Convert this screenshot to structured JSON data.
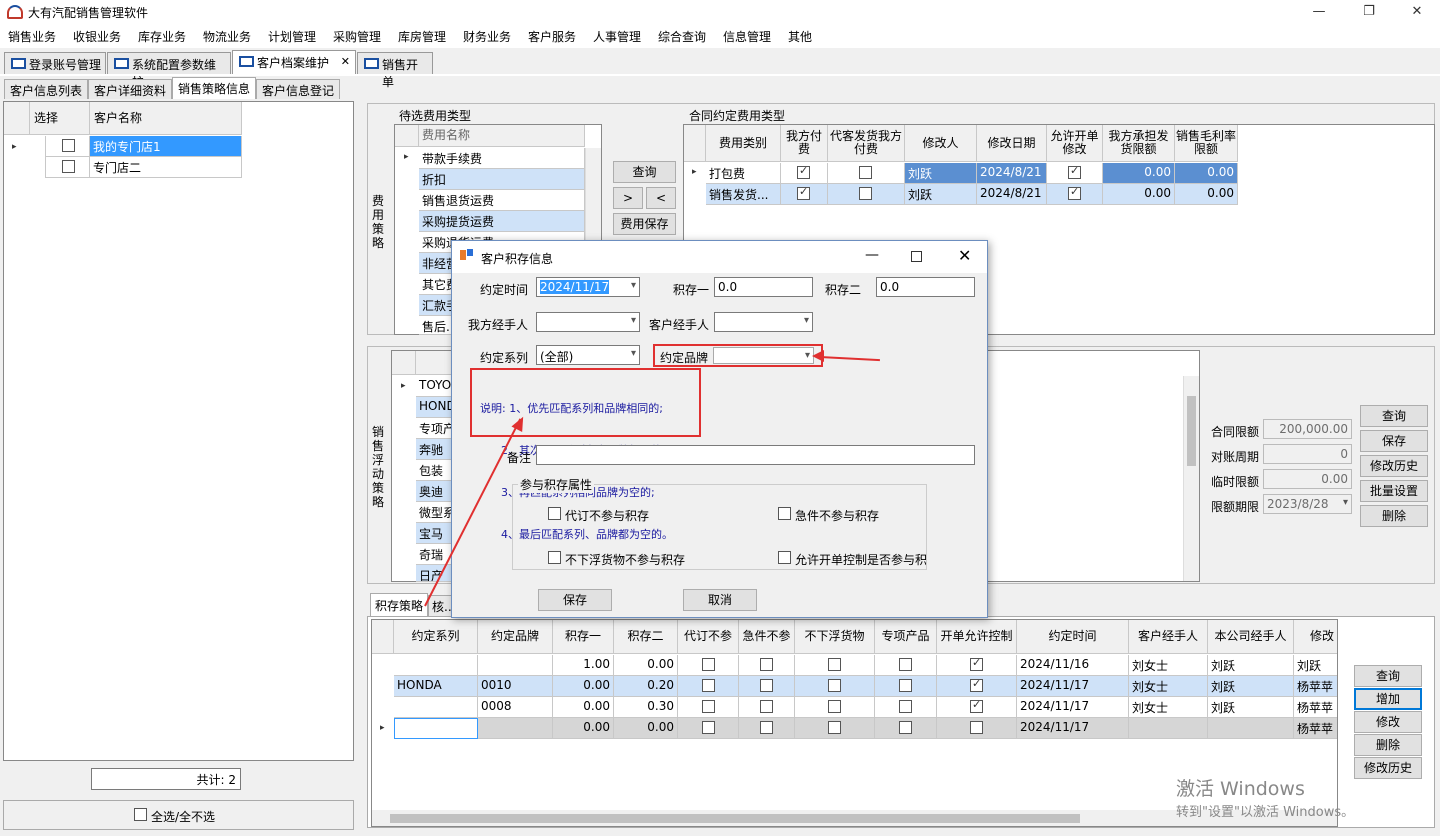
{
  "app": {
    "title": "大有汽配销售管理软件"
  },
  "window": {
    "min": "—",
    "restore": "❐",
    "close": "✕"
  },
  "menu": [
    "销售业务",
    "收银业务",
    "库存业务",
    "物流业务",
    "计划管理",
    "采购管理",
    "库房管理",
    "财务业务",
    "客户服务",
    "人事管理",
    "综合查询",
    "信息管理",
    "其他"
  ],
  "main_tabs": [
    {
      "label": "登录账号管理"
    },
    {
      "label": "系统配置参数维护"
    },
    {
      "label": "客户档案维护",
      "close": "✕"
    },
    {
      "label": "销售开单"
    }
  ],
  "sub_tabs": [
    "客户信息列表",
    "客户详细资料",
    "销售策略信息",
    "客户信息登记"
  ],
  "customer_list": {
    "headers": [
      "选择",
      "客户名称"
    ],
    "rows": [
      {
        "name": "我的专门店1",
        "checked": false
      },
      {
        "name": "专门店二",
        "checked": false
      }
    ],
    "total": "共计: 2",
    "select_all": "全选/全不选"
  },
  "fee_strategy": {
    "label": "费用策略",
    "pending_title": "待选费用类型",
    "pending_header": "费用名称",
    "pending_items": [
      "带款手续费",
      "折扣",
      "销售退货运费",
      "采购提货运费",
      "采购退货运费",
      "非经营...",
      "其它费...",
      "汇款手...",
      "售后..."
    ],
    "buttons": {
      "query": "查询",
      "add": ">",
      "remove": "<",
      "save": "费用保存"
    },
    "contract_title": "合同约定费用类型",
    "contract_headers": [
      "费用类别",
      "我方付费",
      "代客发货我方付费",
      "修改人",
      "修改日期",
      "允许开单修改",
      "我方承担发货限额",
      "销售毛利率限额"
    ],
    "contract_rows": [
      {
        "type": "打包费",
        "ours": true,
        "proxy": false,
        "modifier": "刘跃",
        "date": "2024/8/21",
        "allow": true,
        "limit": "0.00",
        "margin": "0.00"
      },
      {
        "type": "销售发货...",
        "ours": true,
        "proxy": false,
        "modifier": "刘跃",
        "date": "2024/8/21",
        "allow": true,
        "limit": "0.00",
        "margin": "0.00"
      }
    ]
  },
  "float_strategy": {
    "label": "销售浮动策略",
    "brands": [
      "TOYO...",
      "HONDA",
      "专项产...",
      "奔驰",
      "包装",
      "奥迪",
      "微型系...",
      "宝马",
      "奇瑞",
      "日产"
    ],
    "limits": {
      "contract_label": "合同限额",
      "contract_value": "200,000.00",
      "period_label": "对账周期",
      "period_value": "0",
      "temp_label": "临时限额",
      "temp_value": "0.00",
      "expire_label": "限额期限",
      "expire_value": "2023/8/28"
    },
    "buttons": [
      "查询",
      "保存",
      "修改历史",
      "批量设置",
      "删除"
    ]
  },
  "points": {
    "tabs": [
      "积存策略",
      "核..."
    ],
    "headers": [
      "约定系列",
      "约定品牌",
      "积存一",
      "积存二",
      "代订不参",
      "急件不参",
      "不下浮货物",
      "专项产品",
      "开单允许控制",
      "约定时间",
      "客户经手人",
      "本公司经手人",
      "修改"
    ],
    "rows": [
      {
        "series": "",
        "brand": "",
        "p1": "1.00",
        "p2": "0.00",
        "c1": false,
        "c2": false,
        "c3": false,
        "c4": false,
        "c5": true,
        "time": "2024/11/16",
        "cust": "刘女士",
        "ours": "刘跃",
        "mod": "刘跃"
      },
      {
        "series": "HONDA",
        "brand": "0010",
        "p1": "0.00",
        "p2": "0.20",
        "c1": false,
        "c2": false,
        "c3": false,
        "c4": false,
        "c5": true,
        "time": "2024/11/17",
        "cust": "刘女士",
        "ours": "刘跃",
        "mod": "杨苹苹"
      },
      {
        "series": "",
        "brand": "0008",
        "p1": "0.00",
        "p2": "0.30",
        "c1": false,
        "c2": false,
        "c3": false,
        "c4": false,
        "c5": true,
        "time": "2024/11/17",
        "cust": "刘女士",
        "ours": "刘跃",
        "mod": "杨苹苹"
      },
      {
        "series": "",
        "brand": "",
        "p1": "0.00",
        "p2": "0.00",
        "c1": false,
        "c2": false,
        "c3": false,
        "c4": false,
        "c5": false,
        "time": "2024/11/17",
        "cust": "",
        "ours": "",
        "mod": "杨苹苹"
      }
    ],
    "buttons": [
      "查询",
      "增加",
      "修改",
      "删除",
      "修改历史"
    ]
  },
  "dialog": {
    "title": "客户积存信息",
    "date_label": "约定时间",
    "date_value": "2024/11/17",
    "p1_label": "积存一",
    "p1_value": "0.0",
    "p2_label": "积存二",
    "p2_value": "0.0",
    "our_handler_label": "我方经手人",
    "our_handler_value": "",
    "cust_handler_label": "客户经手人",
    "cust_handler_value": "",
    "series_label": "约定系列",
    "series_value": "(全部)",
    "brand_label": "约定品牌",
    "brand_value": "",
    "note_lines": [
      "说明: 1、优先匹配系列和品牌相同的;",
      "      2、其次匹配系列为空品牌相同的;",
      "      3、再匹配系列相同品牌为空的;",
      "      4、最后匹配系列、品牌都为空的。"
    ],
    "remark_label": "备注",
    "remark_value": "",
    "group_title": "参与积存属性",
    "opt1": "代订不参与积存",
    "opt2": "急件不参与积存",
    "opt3": "不下浮货物不参与积存",
    "opt4": "允许开单控制是否参与积",
    "save": "保存",
    "cancel": "取消"
  },
  "watermark": {
    "line1": "激活 Windows",
    "line2": "转到\"设置\"以激活 Windows。"
  },
  "colors": {
    "accent": "#0078d7",
    "annotation": "#e03030",
    "selection": "#3399ff",
    "note": "#1a1aa0"
  }
}
